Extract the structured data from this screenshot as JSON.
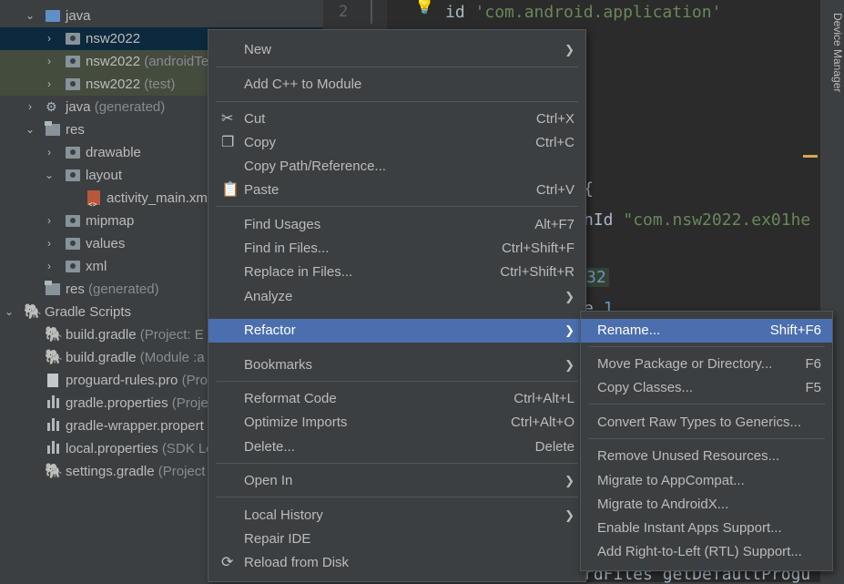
{
  "tree": {
    "items": [
      {
        "label": "java",
        "suffix": ""
      },
      {
        "label": "nsw2022",
        "suffix": ""
      },
      {
        "label": "nsw2022",
        "suffix": " (androidTe"
      },
      {
        "label": "nsw2022",
        "suffix": " (test)"
      },
      {
        "label": "java",
        "suffix": " (generated)"
      },
      {
        "label": "res",
        "suffix": ""
      },
      {
        "label": "drawable",
        "suffix": ""
      },
      {
        "label": "layout",
        "suffix": ""
      },
      {
        "label": "activity_main.xm",
        "suffix": ""
      },
      {
        "label": "mipmap",
        "suffix": ""
      },
      {
        "label": "values",
        "suffix": ""
      },
      {
        "label": "xml",
        "suffix": ""
      },
      {
        "label": "res",
        "suffix": " (generated)"
      },
      {
        "label": "Gradle Scripts",
        "suffix": ""
      },
      {
        "label": "build.gradle",
        "suffix": " (Project: E"
      },
      {
        "label": "build.gradle",
        "suffix": " (Module :a"
      },
      {
        "label": "proguard-rules.pro",
        "suffix": " (Pro"
      },
      {
        "label": "gradle.properties",
        "suffix": " (Proje"
      },
      {
        "label": "gradle-wrapper.propert",
        "suffix": ""
      },
      {
        "label": "local.properties",
        "suffix": " (SDK Lo"
      },
      {
        "label": "settings.gradle",
        "suffix": " (Project"
      }
    ]
  },
  "editor": {
    "line_number": "2",
    "lines": [
      {
        "kw": "id ",
        "str": "'com.android.application'"
      },
      {
        "kw": "{",
        "str": ""
      },
      {
        "kw": "nId ",
        "str": "\"com.nsw2022.ex01he"
      },
      {
        "kw": "",
        "num": "32"
      },
      {
        "kw": "e ",
        "num": "1"
      },
      {
        "kw": "rdFiles getDefaultProgu",
        "str": ""
      }
    ]
  },
  "right_toolbar": {
    "device_manager": "Device Manager"
  },
  "context_menu": {
    "new": "New",
    "add_cpp": "Add C++ to Module",
    "cut": "Cut",
    "cut_key": "Ctrl+X",
    "copy": "Copy",
    "copy_key": "Ctrl+C",
    "copy_path": "Copy Path/Reference...",
    "paste": "Paste",
    "paste_key": "Ctrl+V",
    "find_usages": "Find Usages",
    "find_usages_key": "Alt+F7",
    "find_in_files": "Find in Files...",
    "find_in_files_key": "Ctrl+Shift+F",
    "replace_in_files": "Replace in Files...",
    "replace_in_files_key": "Ctrl+Shift+R",
    "analyze": "Analyze",
    "refactor": "Refactor",
    "bookmarks": "Bookmarks",
    "reformat": "Reformat Code",
    "reformat_key": "Ctrl+Alt+L",
    "optimize": "Optimize Imports",
    "optimize_key": "Ctrl+Alt+O",
    "delete": "Delete...",
    "delete_key": "Delete",
    "open_in": "Open In",
    "local_history": "Local History",
    "repair_ide": "Repair IDE",
    "reload": "Reload from Disk"
  },
  "refactor_menu": {
    "rename": "Rename...",
    "rename_key": "Shift+F6",
    "move": "Move Package or Directory...",
    "move_key": "F6",
    "copy_classes": "Copy Classes...",
    "copy_classes_key": "F5",
    "convert_raw": "Convert Raw Types to Generics...",
    "remove_unused": "Remove Unused Resources...",
    "migrate_appcompat": "Migrate to AppCompat...",
    "migrate_androidx": "Migrate to AndroidX...",
    "instant_apps": "Enable Instant Apps Support...",
    "rtl": "Add Right-to-Left (RTL) Support..."
  },
  "colors": {
    "selection": "#4b6eaf",
    "menu_bg": "#3c3f41",
    "editor_bg": "#2b2b2b",
    "string": "#6a8759",
    "number": "#6897bb"
  },
  "icons": [
    "scissors-icon",
    "copy-icon",
    "clipboard-icon",
    "reload-icon",
    "bulb-icon",
    "folder-icon",
    "package-icon",
    "gradle-elephant-icon",
    "xml-file-icon",
    "chevron-right-icon",
    "chevron-down-icon"
  ]
}
